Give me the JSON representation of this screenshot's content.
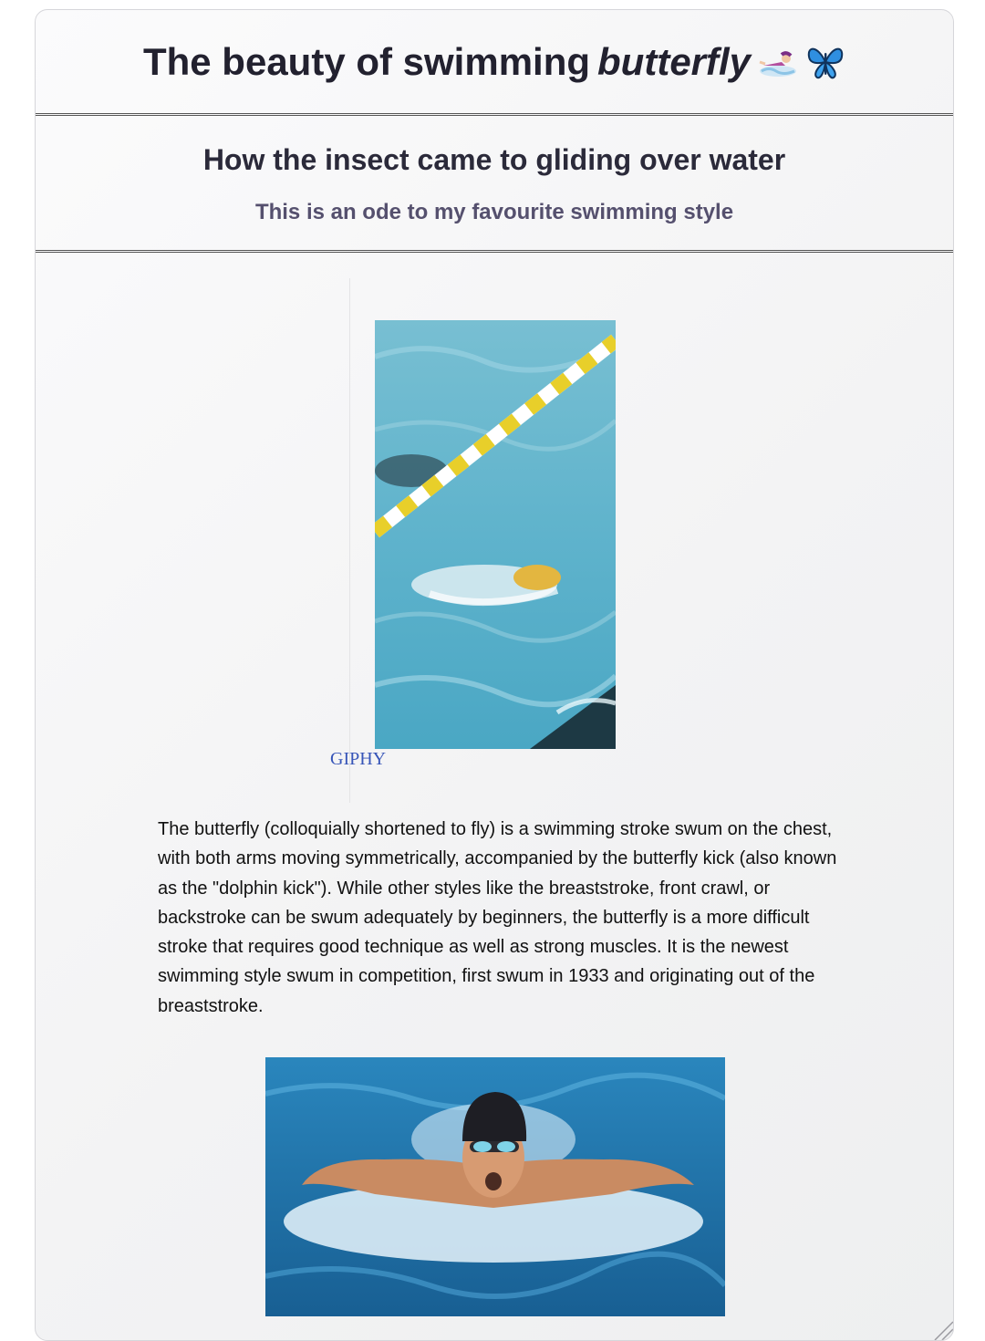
{
  "header": {
    "title_prefix": "The beauty of swimming",
    "title_emphasis": "butterfly",
    "icons": [
      "swimmer-icon",
      "butterfly-icon"
    ]
  },
  "intro": {
    "subtitle": "How the insect came to gliding over water",
    "tagline": "This is an ode to my favourite swimming style"
  },
  "media": {
    "gif_link_text": "GIPHY"
  },
  "article": {
    "description": "The butterfly (colloquially shortened to fly) is a swimming stroke swum on the chest, with both arms moving symmetrically, accompanied by the butterfly kick (also known as the \"dolphin kick\"). While other styles like the breaststroke, front crawl, or backstroke can be swum adequately by beginners, the butterfly is a more difficult stroke that requires good technique as well as strong muscles. It is the newest swimming style swum in competition, first swum in 1933 and originating out of the breaststroke."
  },
  "colors": {
    "title_text": "#22212f",
    "tagline_text": "#55506e",
    "link": "#3755b8",
    "pool_water": "#5fb3cc",
    "lane_rope_yellow": "#e8cf2a"
  }
}
